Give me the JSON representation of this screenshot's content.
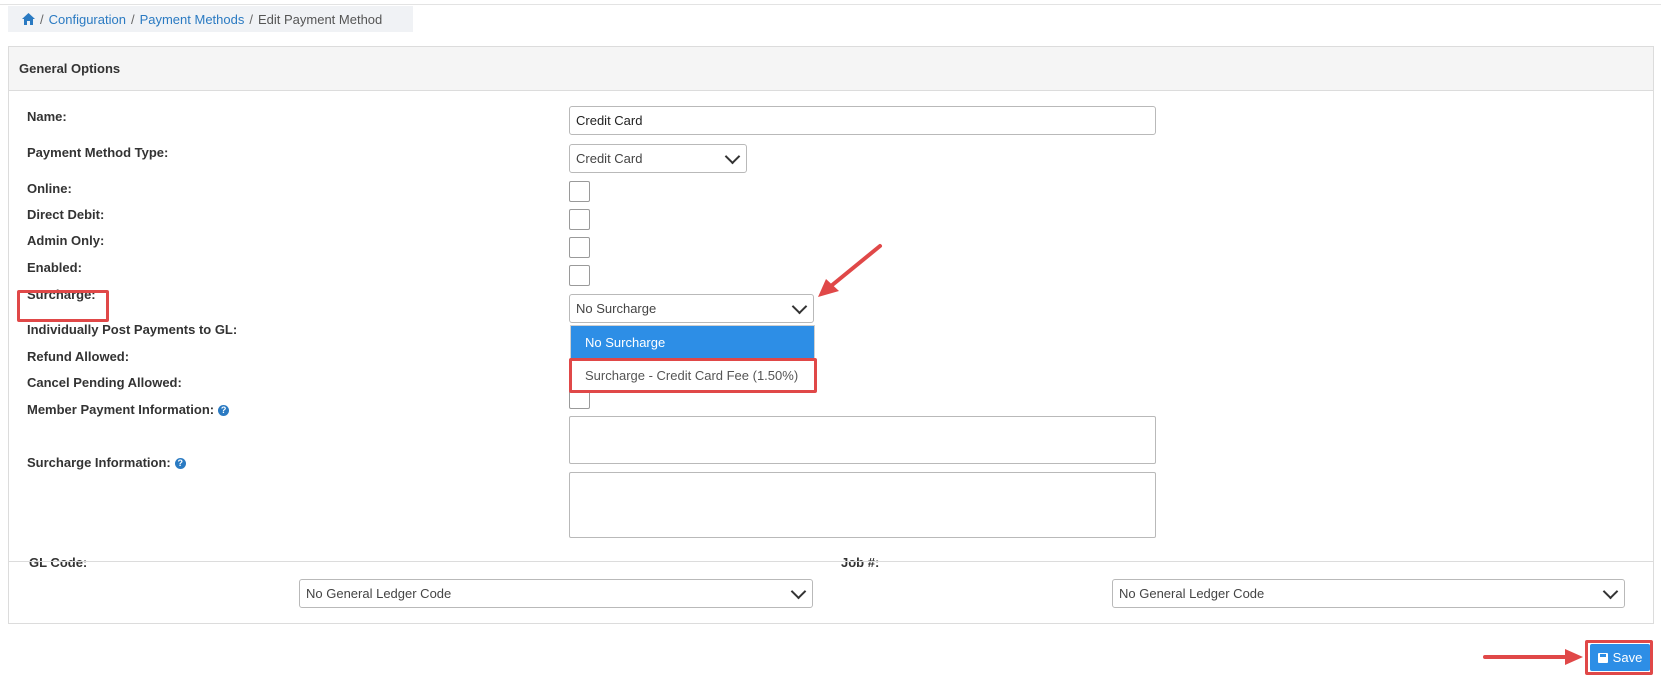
{
  "breadcrumb": {
    "home_icon": "home-icon",
    "separator": "/",
    "items": [
      "Configuration",
      "Payment Methods"
    ],
    "current": "Edit Payment Method"
  },
  "panel": {
    "title": "General Options"
  },
  "form": {
    "name_label": "Name:",
    "name_value": "Credit Card",
    "type_label": "Payment Method Type:",
    "type_value": "Credit Card",
    "online_label": "Online:",
    "direct_debit_label": "Direct Debit:",
    "admin_only_label": "Admin Only:",
    "enabled_label": "Enabled:",
    "surcharge_label": "Surcharge:",
    "surcharge_value": "No Surcharge",
    "surcharge_options": [
      "No Surcharge",
      "Surcharge - Credit Card Fee (1.50%)"
    ],
    "post_gl_label": "Individually Post Payments to GL:",
    "refund_label": "Refund Allowed:",
    "cancel_pending_label": "Cancel Pending Allowed:",
    "member_info_label": "Member Payment Information:",
    "surcharge_info_label": "Surcharge Information:"
  },
  "footer": {
    "gl_code_label": "GL Code:",
    "gl_code_value": "No General Ledger Code",
    "job_label": "Job #:",
    "job_value": "No General Ledger Code"
  },
  "save_label": "Save",
  "colors": {
    "accent": "#2d8ee6",
    "highlight": "#e04848",
    "link": "#2a7ac2"
  }
}
